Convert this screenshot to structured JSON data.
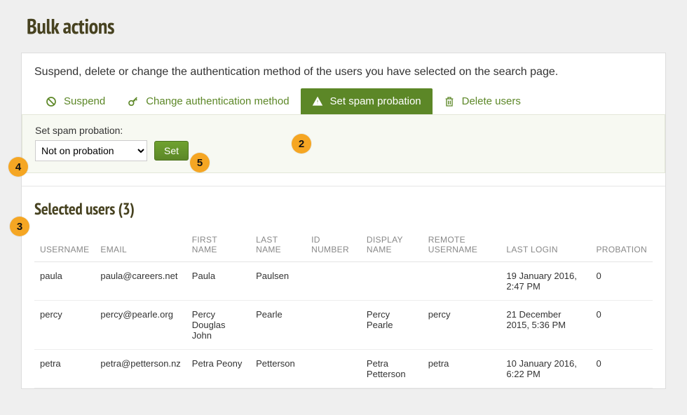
{
  "page_title": "Bulk actions",
  "intro": "Suspend, delete or change the authentication method of the users you have selected on the search page.",
  "tabs": {
    "suspend": "Suspend",
    "change_auth": "Change authentication method",
    "set_spam": "Set spam probation",
    "delete": "Delete users"
  },
  "panel": {
    "label": "Set spam probation:",
    "selected_option": "Not on probation",
    "set_button": "Set"
  },
  "selected_users_heading": "Selected users (3)",
  "columns": {
    "username": "USERNAME",
    "email": "EMAIL",
    "first_name": "FIRST NAME",
    "last_name": "LAST NAME",
    "id_number": "ID NUMBER",
    "display_name": "DISPLAY NAME",
    "remote_username": "REMOTE USERNAME",
    "last_login": "LAST LOGIN",
    "probation": "PROBATION"
  },
  "rows": [
    {
      "username": "paula",
      "email": "paula@careers.net",
      "first_name": "Paula",
      "last_name": "Paulsen",
      "id_number": "",
      "display_name": "",
      "remote_username": "",
      "last_login": "19 January 2016, 2:47 PM",
      "probation": "0"
    },
    {
      "username": "percy",
      "email": "percy@pearle.org",
      "first_name": "Percy Douglas John",
      "last_name": "Pearle",
      "id_number": "",
      "display_name": "Percy Pearle",
      "remote_username": "percy",
      "last_login": "21 December 2015, 5:36 PM",
      "probation": "0"
    },
    {
      "username": "petra",
      "email": "petra@petterson.nz",
      "first_name": "Petra Peony",
      "last_name": "Petterson",
      "id_number": "",
      "display_name": "Petra Petterson",
      "remote_username": "petra",
      "last_login": "10 January 2016, 6:22 PM",
      "probation": "0"
    }
  ],
  "badges": {
    "b2": "2",
    "b3": "3",
    "b4": "4",
    "b5": "5"
  }
}
